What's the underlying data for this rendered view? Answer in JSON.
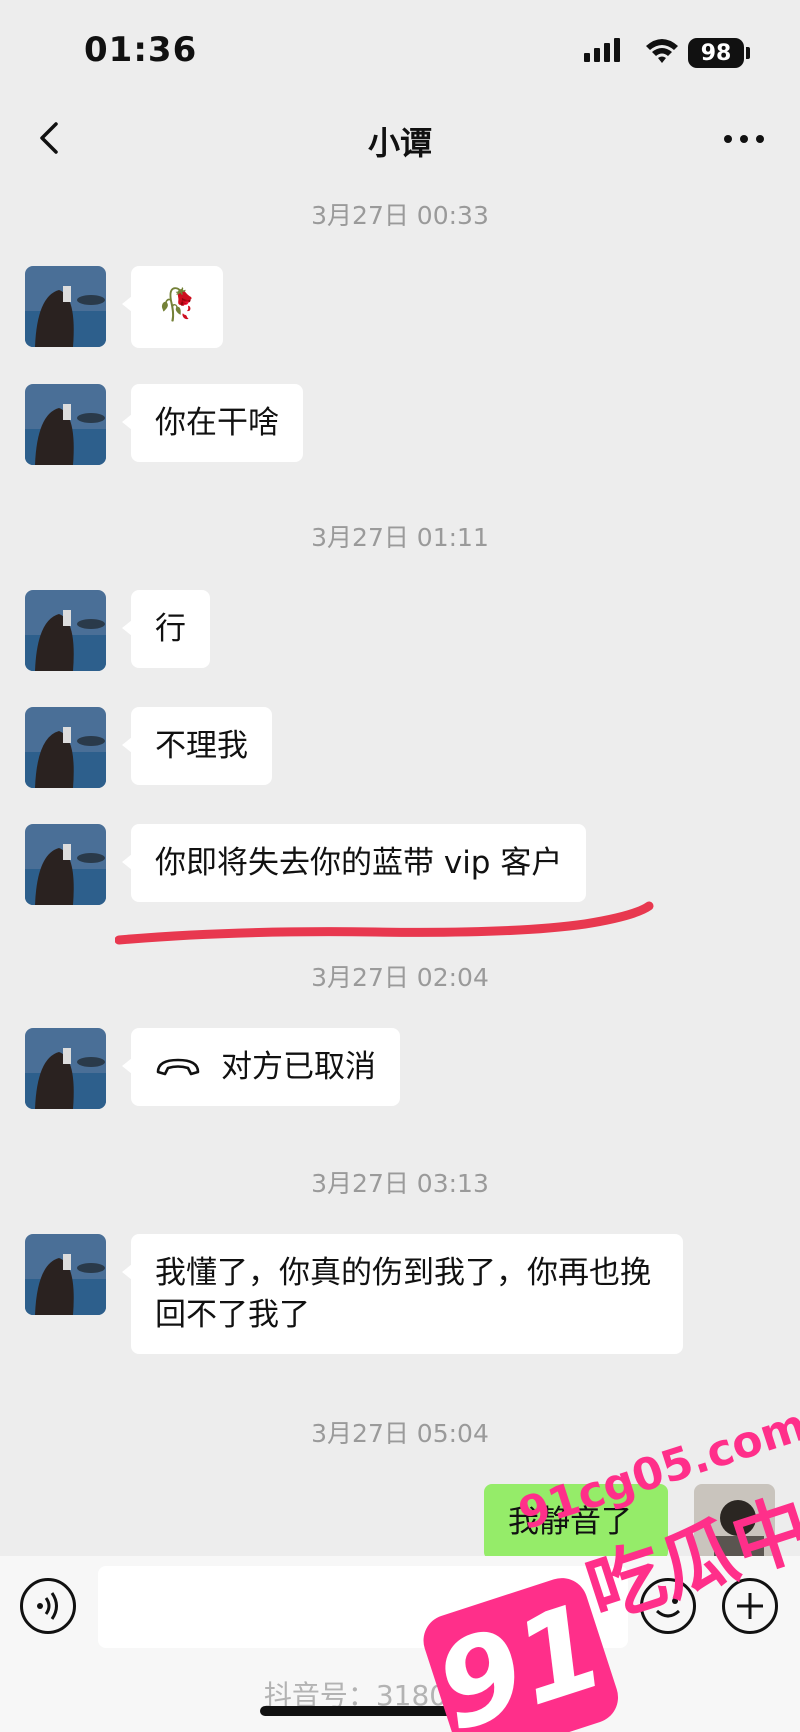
{
  "status": {
    "time": "01:36",
    "battery": "98"
  },
  "nav": {
    "title": "小谭"
  },
  "messages": {
    "ts1": "3月27日 00:33",
    "m1_emoji": "🥀",
    "m2": "你在干啥",
    "ts2": "3月27日 01:11",
    "m3": "行",
    "m4": "不理我",
    "m5": "你即将失去你的蓝带 vip 客户",
    "ts3": "3月27日 02:04",
    "call": "对方已取消",
    "ts4": "3月27日 03:13",
    "m6": "我懂了，你真的伤到我了，你再也挽回不了我了",
    "ts5": "3月27日 05:04",
    "sent1": "我静音了"
  },
  "footer": {
    "tiktok_id": "抖音号：3180  38  87"
  },
  "watermark": {
    "domain": "91cg05.com",
    "number": "91",
    "name": "吃瓜中心"
  },
  "colors": {
    "background": "#ededed",
    "sent_bubble": "#95ec69",
    "underline": "#e8384f",
    "watermark": "#ff2f8a"
  }
}
